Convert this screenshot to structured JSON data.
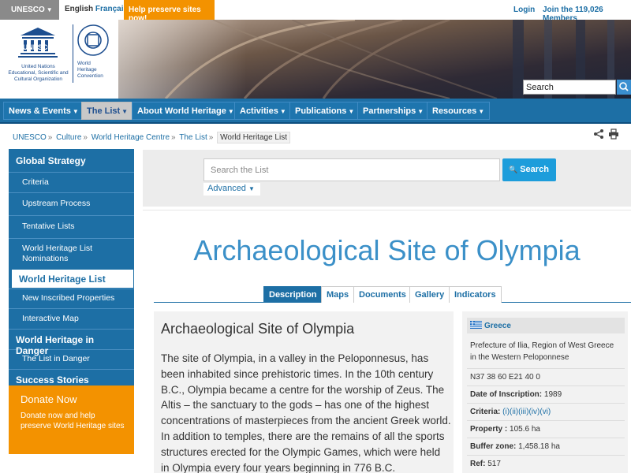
{
  "topbar": {
    "unesco_label": "UNESCO",
    "lang_en": "English",
    "lang_fr": "Français",
    "help_label": "Help preserve sites now!",
    "login_label": "Login",
    "join_label": "Join the 119,026 Members"
  },
  "header": {
    "unesco_wordmark": "UNESCO",
    "org_name_1": "United Nations",
    "org_name_2": "Educational, Scientific and",
    "org_name_3": "Cultural Organization",
    "convention_1": "World",
    "convention_2": "Heritage",
    "convention_3": "Convention",
    "search_value": "Search"
  },
  "nav": {
    "items": [
      {
        "label": "News & Events"
      },
      {
        "label": "The List"
      },
      {
        "label": "About World Heritage"
      },
      {
        "label": "Activities"
      },
      {
        "label": "Publications"
      },
      {
        "label": "Partnerships"
      },
      {
        "label": "Resources"
      }
    ]
  },
  "breadcrumb": {
    "items": [
      "UNESCO",
      "Culture",
      "World Heritage Centre",
      "The List",
      "World Heritage List"
    ]
  },
  "sidebar": {
    "global_strategy": "Global Strategy",
    "gs_items": [
      "Criteria",
      "Upstream Process",
      "Tentative Lists",
      "World Heritage List Nominations"
    ],
    "current": "World Heritage List",
    "whl_items": [
      "New Inscribed Properties",
      "Interactive Map"
    ],
    "in_danger": "World Heritage in Danger",
    "danger_items": [
      "The List in Danger"
    ],
    "success": "Success Stories"
  },
  "donate": {
    "title": "Donate Now",
    "text": "Donate now and help preserve World Heritage sites"
  },
  "list_search": {
    "placeholder": "Search the List",
    "button": "Search",
    "advanced": "Advanced"
  },
  "page": {
    "title": "Archaeological Site of Olympia",
    "tabs": [
      "Description",
      "Maps",
      "Documents",
      "Gallery",
      "Indicators"
    ]
  },
  "description": {
    "heading": "Archaeological Site of Olympia",
    "text": "The site of Olympia, in a valley in the Peloponnesus, has been inhabited since prehistoric times. In the 10th century B.C., Olympia became a centre for the worship of Zeus. The Altis – the sanctuary to the gods – has one of the highest concentrations of masterpieces from the ancient Greek world. In addition to temples, there are the remains of all the sports structures erected for the Olympic Games, which were held in Olympia every four years beginning in 776 B.C."
  },
  "facts": {
    "country": "Greece",
    "location": "Prefecture of Ilia, Region of West Greece in the Western Peloponnese",
    "coords": "N37 38 60 E21 40 0",
    "inscription_label": "Date of Inscription:",
    "inscription_value": "1989",
    "criteria_label": "Criteria:",
    "criteria_value": "(i)(ii)(iii)(iv)(vi)",
    "property_label": "Property :",
    "property_value": "105.6 ha",
    "buffer_label": "Buffer zone:",
    "buffer_value": "1,458.18 ha",
    "ref_label": "Ref:",
    "ref_value": "517"
  },
  "colors": {
    "brand_blue": "#1d6fa5",
    "accent_orange": "#f39200",
    "title_blue": "#3b90c8"
  }
}
